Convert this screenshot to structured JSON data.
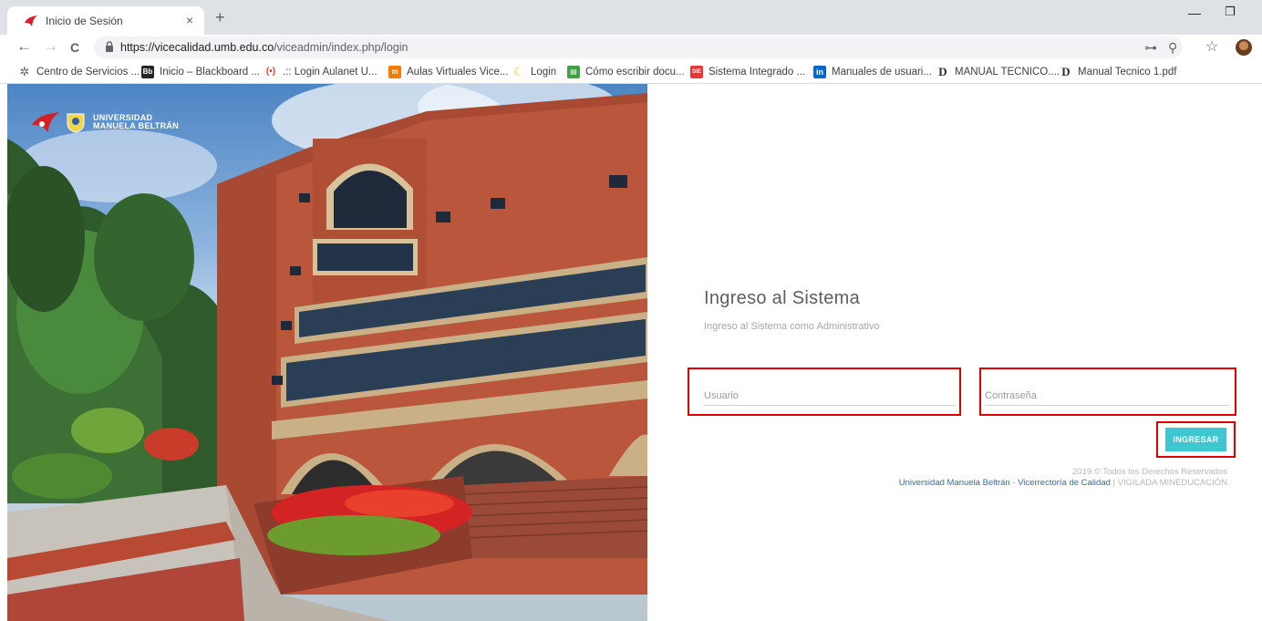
{
  "browser": {
    "tab_title": "Inicio de Sesión",
    "tab_close": "×",
    "new_tab": "+",
    "win_minimize": "—",
    "win_maximize": "❐",
    "nav_back": "←",
    "nav_forward": "→",
    "nav_reload": "C",
    "url_host": "https://vicecalidad.umb.edu.co",
    "url_path": "/viceadmin/index.php/login",
    "key_icon": "⊶",
    "zoom_icon": "⚲",
    "star_icon": "☆",
    "bookmarks": [
      {
        "label": "Centro de Servicios ...",
        "icon": "apps-icon",
        "color": "#5f6368"
      },
      {
        "label": "Inicio – Blackboard ...",
        "icon": "blackboard-icon",
        "color": "#262626",
        "glyph": "Bb"
      },
      {
        "label": ".:: Login Aulanet U...",
        "icon": "aulanet-icon",
        "color": "#e53935"
      },
      {
        "label": "Aulas Virtuales Vice...",
        "icon": "moodle-icon",
        "color": "#f57c00",
        "glyph": "m"
      },
      {
        "label": "Login",
        "icon": "login-icon",
        "color": "#fbc02d"
      },
      {
        "label": "Cómo escribir docu...",
        "icon": "docs-icon",
        "color": "#43a047"
      },
      {
        "label": "Sistema Integrado ...",
        "icon": "sie-icon",
        "color": "#e53935",
        "glyph": "SIE"
      },
      {
        "label": "Manuales de usuari...",
        "icon": "linkedin-icon",
        "color": "#0a66c2",
        "glyph": "in"
      },
      {
        "label": "MANUAL TECNICO....",
        "icon": "doc-d-icon",
        "color": "#ffffff",
        "glyph": "D"
      },
      {
        "label": "Manual Tecnico 1.pdf",
        "icon": "doc-d-icon",
        "color": "#ffffff",
        "glyph": "D"
      }
    ]
  },
  "hero": {
    "logo_line1": "UNIVERSIDAD",
    "logo_line2": "MANUELA BELTRÁN"
  },
  "login": {
    "title": "Ingreso al Sistema",
    "subtitle": "Ingreso al Sistema como Administrativo",
    "username_placeholder": "Usuario",
    "password_placeholder": "Contraseña",
    "submit_label": "INGRESAR"
  },
  "footer": {
    "copyright": "2019 © Todos los Derechos Reservados",
    "institution_link": "Universidad Manuela Beltrán · Vicerrectoría de Calidad",
    "separator": "|",
    "vigilada": "VIGILADA MINEDUCACIÓN"
  },
  "colors": {
    "accent_button": "#3ec7d0",
    "highlight_border": "#e00000",
    "link": "#2a6fb0"
  }
}
